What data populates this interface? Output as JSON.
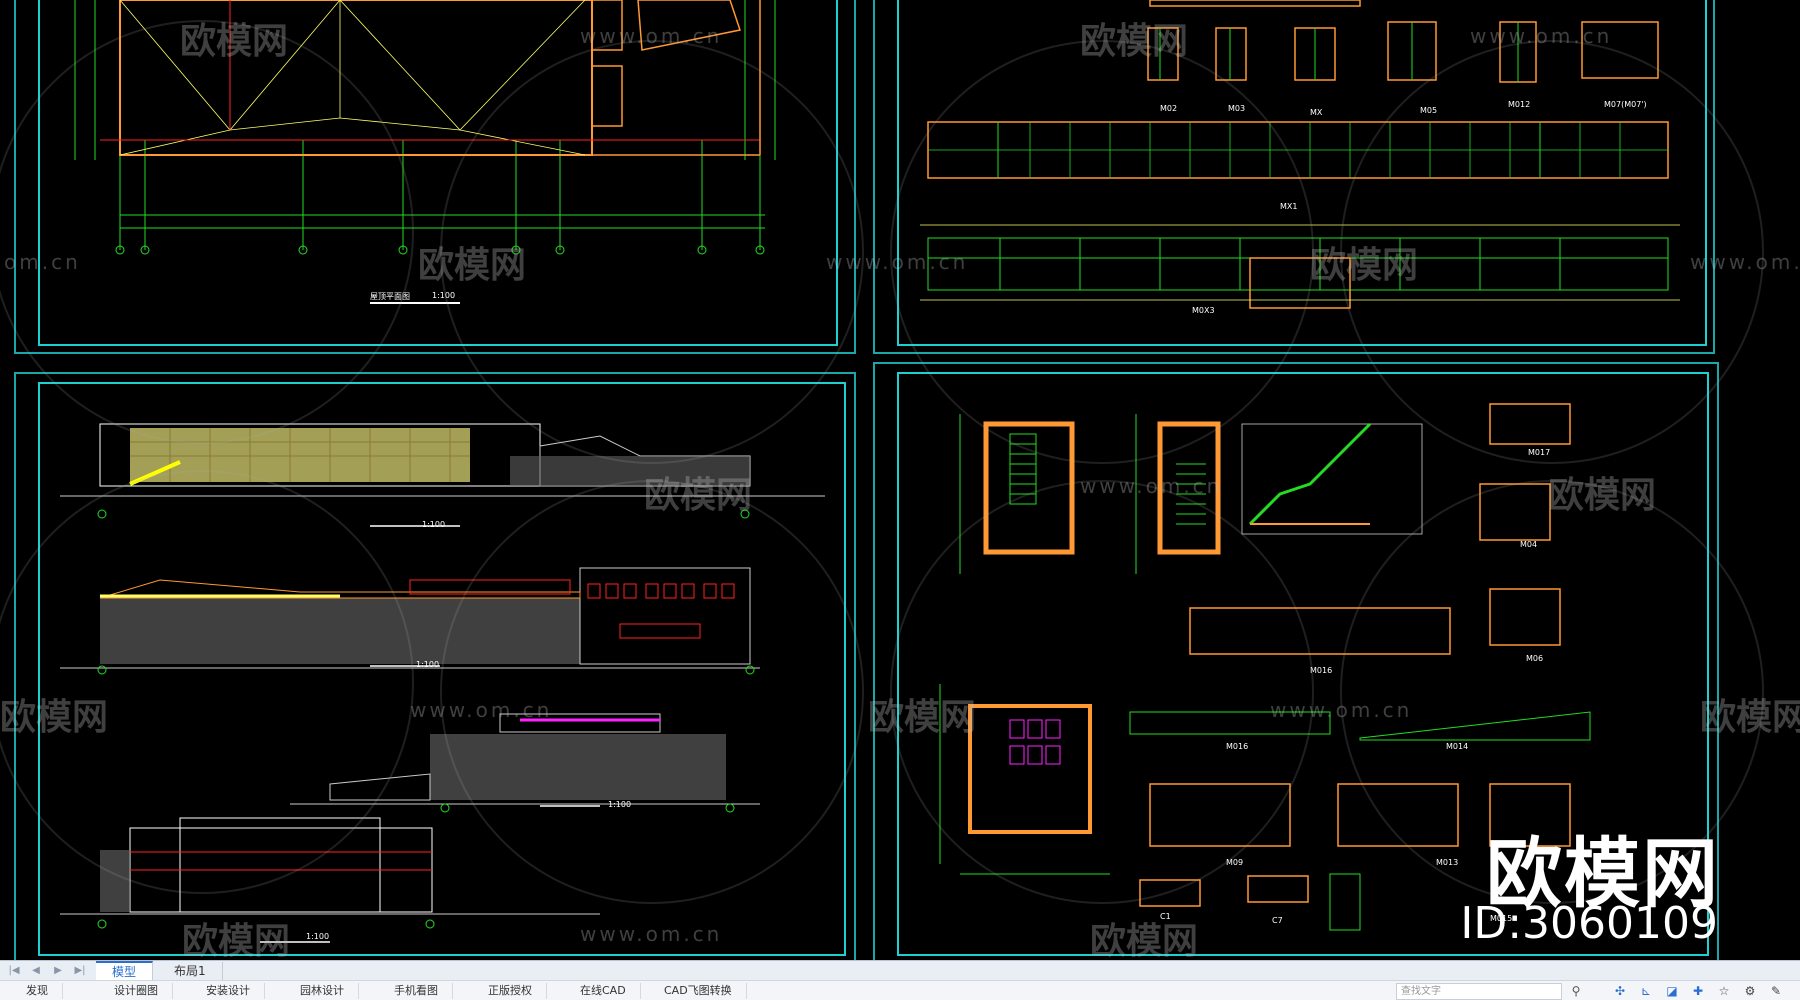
{
  "watermark": {
    "brand": "欧模网",
    "url": "www.om.cn",
    "url_short": "om.cn",
    "id_text": "ID:3060109"
  },
  "captions": {
    "roof_plan": "屋顶平面图",
    "roof_scale": "1:100",
    "elev1_scale": "1:100",
    "elev2_scale": "1:100",
    "elev3_scale": "1:100",
    "elev4_scale": "1:100",
    "door_labels": [
      "M02",
      "M03",
      "MX",
      "M05",
      "M012",
      "M07(M07')",
      "MX1",
      "M0X3"
    ],
    "detail_labels": [
      "M017",
      "M04",
      "M06",
      "M016",
      "M016",
      "M014",
      "M09",
      "M013",
      "M015",
      "C1",
      "C7"
    ]
  },
  "tabs": [
    {
      "label": "模型",
      "active": true
    },
    {
      "label": "布局1",
      "active": false
    }
  ],
  "toolbar": {
    "items": [
      "发现",
      "设计圈图",
      "安装设计",
      "园林设计",
      "手机看图",
      "正版授权",
      "在线CAD",
      "CAD飞图转换"
    ],
    "search_placeholder": "查找文字"
  },
  "colors": {
    "frame": "#1fd0d0",
    "line_green": "#22dd22",
    "line_red": "#ff2222",
    "line_orange": "#ff9933",
    "line_yellow": "#ffff66",
    "line_magenta": "#ff22ff"
  }
}
